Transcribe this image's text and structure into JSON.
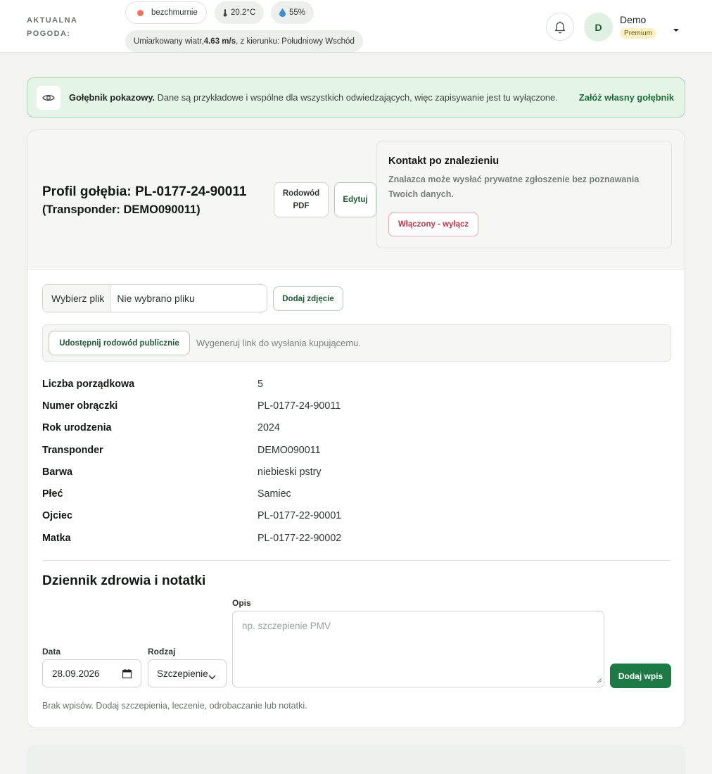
{
  "weather": {
    "label": "AKTUALNA POGODA:",
    "condition": "bezchmurnie",
    "temperature": "20.2°C",
    "humidity": "55%",
    "wind_prefix": "Umiarkowany wiatr,",
    "wind_speed": "4.63 m/s",
    "wind_suffix": ", z kierunku: Południowy Wschód",
    "condition_color": "#e8765c"
  },
  "user": {
    "initial": "D",
    "name": "Demo",
    "plan": "Premium"
  },
  "banner": {
    "bold": "Gołębnik pokazowy.",
    "text": " Dane są przykładowe i wspólne dla wszystkich odwiedzających, więc zapisywanie jest tu wyłączone.",
    "link": "Załóż własny gołębnik"
  },
  "profile": {
    "title": "Profil gołębia: PL-0177-24-90011",
    "subtitle": "(Transponder: DEMO090011)",
    "pdf_line1": "Rodowód",
    "pdf_line2": "PDF",
    "edit_label": "Edytuj"
  },
  "contact": {
    "title": "Kontakt po znalezieniu",
    "description": "Znalazca może wysłać prywatne zgłoszenie bez poznawania Twoich danych.",
    "toggle_label": "Włączony - wyłącz"
  },
  "photo": {
    "choose_label": "Wybierz plik",
    "no_file": "Nie wybrano pliku",
    "add_label": "Dodaj zdjęcie"
  },
  "share": {
    "button_label": "Udostępnij rodowód publicznie",
    "hint": "Wygeneruj link do wysłania kupującemu."
  },
  "details": [
    {
      "key": "Liczba porządkowa",
      "value": "5"
    },
    {
      "key": "Numer obrączki",
      "value": "PL-0177-24-90011"
    },
    {
      "key": "Rok urodzenia",
      "value": "2024"
    },
    {
      "key": "Transponder",
      "value": "DEMO090011"
    },
    {
      "key": "Barwa",
      "value": "niebieski pstry"
    },
    {
      "key": "Płeć",
      "value": "Samiec"
    },
    {
      "key": "Ojciec",
      "value": "PL-0177-22-90001"
    },
    {
      "key": "Matka",
      "value": "PL-0177-22-90002"
    }
  ],
  "health": {
    "title": "Dziennik zdrowia i notatki",
    "date_label": "Data",
    "date_value": "28.09.2026",
    "type_label": "Rodzaj",
    "type_value": "Szczepienie",
    "desc_label": "Opis",
    "desc_placeholder": "np. szczepienie PMV",
    "add_label": "Dodaj wpis",
    "empty_note": "Brak wpisów. Dodaj szczepienia, leczenie, odrobaczanie lub notatki."
  }
}
